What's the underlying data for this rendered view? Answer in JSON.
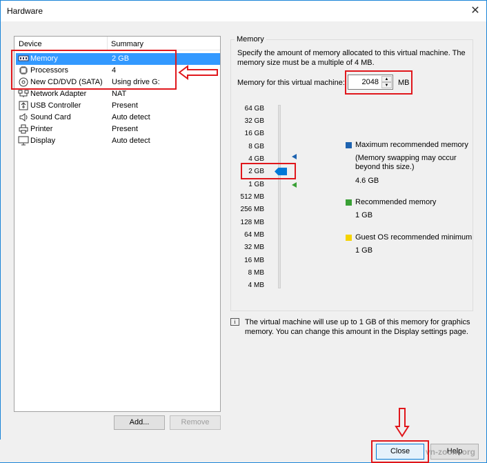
{
  "window": {
    "title": "Hardware"
  },
  "device_table": {
    "headers": {
      "device": "Device",
      "summary": "Summary"
    },
    "rows": [
      {
        "icon": "memory-icon",
        "name": "Memory",
        "summary": "2 GB",
        "selected": true
      },
      {
        "icon": "processor-icon",
        "name": "Processors",
        "summary": "4"
      },
      {
        "icon": "cd-dvd-icon",
        "name": "New CD/DVD (SATA)",
        "summary": "Using drive G:"
      },
      {
        "icon": "network-adapter-icon",
        "name": "Network Adapter",
        "summary": "NAT"
      },
      {
        "icon": "usb-icon",
        "name": "USB Controller",
        "summary": "Present"
      },
      {
        "icon": "sound-card-icon",
        "name": "Sound Card",
        "summary": "Auto detect"
      },
      {
        "icon": "printer-icon",
        "name": "Printer",
        "summary": "Present"
      },
      {
        "icon": "display-icon",
        "name": "Display",
        "summary": "Auto detect"
      }
    ]
  },
  "buttons": {
    "add": "Add...",
    "remove": "Remove",
    "close": "Close",
    "help": "Help"
  },
  "memory": {
    "group_label": "Memory",
    "description": "Specify the amount of memory allocated to this virtual machine. The memory size must be a multiple of 4 MB.",
    "field_label": "Memory for this virtual machine:",
    "value": "2048",
    "unit": "MB",
    "scale": [
      "64 GB",
      "32 GB",
      "16 GB",
      "8 GB",
      "4 GB",
      "2 GB",
      "1 GB",
      "512 MB",
      "256 MB",
      "128 MB",
      "64 MB",
      "32 MB",
      "16 MB",
      "8 MB",
      "4 MB"
    ],
    "max_recommended": {
      "label": "Maximum recommended memory",
      "note": "(Memory swapping may occur beyond this size.)",
      "value": "4.6 GB",
      "color": "#1e63b0"
    },
    "recommended": {
      "label": "Recommended memory",
      "value": "1 GB",
      "color": "#39a035"
    },
    "guest_min": {
      "label": "Guest OS recommended minimum",
      "value": "1 GB",
      "color": "#f5d300"
    },
    "info": "The virtual machine will use up to 1 GB of this memory for graphics memory. You can change this amount in the Display settings page."
  },
  "watermark": "vn-zoom.org"
}
